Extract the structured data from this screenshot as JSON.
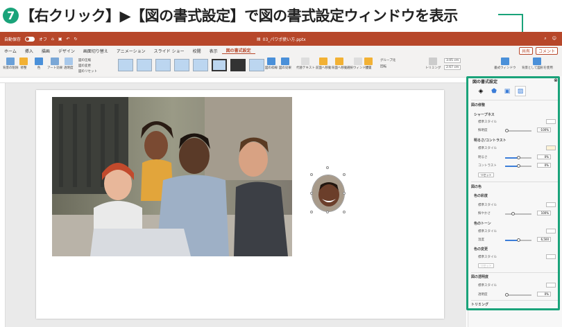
{
  "caption": {
    "step": "7",
    "text": "【右クリック】▶【図の書式設定】で図の書式設定ウィンドウを表示"
  },
  "titlebar": {
    "autosave": "自動保存",
    "autosave_state": "オフ",
    "filename": "03_パワポ使い方.pptx"
  },
  "tabs": [
    "ホーム",
    "挿入",
    "描画",
    "デザイン",
    "画面切り替え",
    "アニメーション",
    "スライド ショー",
    "校閲",
    "表示",
    "図の書式設定"
  ],
  "tabs_right": {
    "share": "共有",
    "comment": "コメント"
  },
  "ribbon": {
    "remove_bg": "背景の削除",
    "corrections": "修整",
    "color": "色",
    "artistic": "アート効果",
    "transparency": "透明度",
    "compress": "図の圧縮",
    "change_picture": "図の変更",
    "reset_picture": "図のリセット",
    "picture_border": "図の枠線",
    "picture_effects": "図の効果",
    "alt_text": "代替テキスト",
    "bring_forward": "前面へ移動",
    "send_backward": "背面へ移動",
    "selection_pane": "選択ウィンドウ",
    "align": "配置",
    "group": "グループ化",
    "rotate": "回転",
    "crop": "トリミング",
    "height": "3.05 cm",
    "width": "2.67 cm",
    "format_pane": "書式ウィンドウ",
    "set_as_background": "背景として図形を使用"
  },
  "pane": {
    "title": "図の書式設定",
    "sections": {
      "correction": "図の修整",
      "sharpen": "シャープネス",
      "brightness_contrast": "明るさ/コントラスト",
      "color": "図の色",
      "saturation_head": "色の彩度",
      "tone_head": "色のトーン",
      "recolor_head": "色の変更",
      "transparency": "図の透明度",
      "crop": "トリミング"
    },
    "labels": {
      "preset": "標準スタイル",
      "sharpness": "鮮明度",
      "brightness": "明るさ",
      "contrast": "コントラスト",
      "reset": "リセット",
      "saturation": "鮮やかさ",
      "temperature": "温度",
      "transparency": "透明度"
    },
    "values": {
      "sharpness": "-100%",
      "brightness": "0%",
      "contrast": "0%",
      "saturation": "100%",
      "temperature": "6,500",
      "transparency": "0%"
    }
  },
  "colors": {
    "accent": "#1aa37a",
    "brand": "#b7472a"
  },
  "icons": [
    "home-icon",
    "save-icon",
    "undo-icon",
    "redo-icon",
    "fill-icon",
    "effects-icon",
    "layout-icon",
    "picture-icon",
    "settings-icon",
    "face-icon"
  ]
}
